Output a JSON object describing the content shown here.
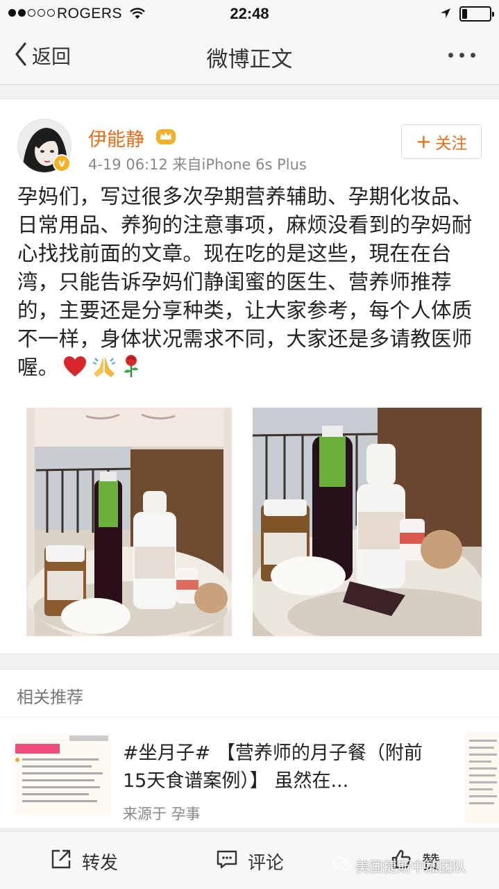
{
  "status_bar": {
    "carrier": "ROGERS",
    "time": "22:48",
    "signal_bars_filled": 2,
    "signal_bars_total": 5,
    "battery_level": 0.18,
    "icons": [
      "wifi-icon",
      "location-arrow-icon",
      "battery-icon"
    ]
  },
  "nav": {
    "back_label": "返回",
    "title": "微博正文",
    "icons": [
      "chevron-left-icon",
      "more-dots-icon"
    ]
  },
  "post": {
    "username": "伊能静",
    "timestamp": "4-19 06:12",
    "source": "来自iPhone 6s Plus",
    "follow_label": "关注",
    "body": "孕妈们，写过很多次孕期营养辅助、孕期化妆品、日常用品、养狗的注意事项，麻烦没看到的孕妈耐心找找前面的文章。现在吃的是这些，現在在台湾，只能告诉孕妈们静闺蜜的医生、营养师推荐的，主要还是分享种类，让大家参考，每个人体质不一样，身体状况需求不同，大家还是多请教医师喔。",
    "emojis": [
      "heart-emoji",
      "folded-hands-emoji",
      "rose-emoji"
    ],
    "colors": {
      "accent": "#e86c17",
      "verified": "#f6b024"
    }
  },
  "related": {
    "title": "相关推荐",
    "item": {
      "text": "#坐月子# 【营养师的月子餐（附前15天食谱案例）】 虽然在...",
      "source": "来源于 孕事"
    }
  },
  "bottom_bar": {
    "repost_label": "转发",
    "comment_label": "评论",
    "like_label": "赞"
  },
  "watermark": "美国捷斯中加团队"
}
